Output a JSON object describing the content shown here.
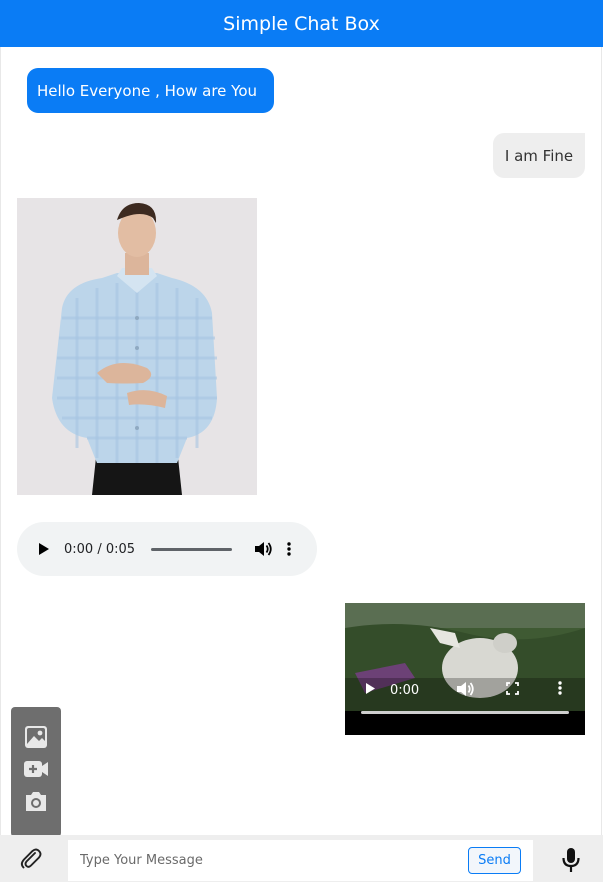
{
  "header": {
    "title": "Simple Chat Box"
  },
  "messages": {
    "incoming_text": "Hello Everyone , How are You",
    "outgoing_text": "I am Fine",
    "audio": {
      "time": "0:00 / 0:05",
      "progress": 0
    },
    "video": {
      "time": "0:00",
      "progress": 0
    }
  },
  "attach_menu": {
    "items": [
      "image-icon",
      "video-add-icon",
      "camera-icon"
    ]
  },
  "composer": {
    "placeholder": "Type Your Message",
    "value": "",
    "send_label": "Send"
  },
  "colors": {
    "accent": "#0a7cf5",
    "bubble_out": "#eeeeee"
  }
}
